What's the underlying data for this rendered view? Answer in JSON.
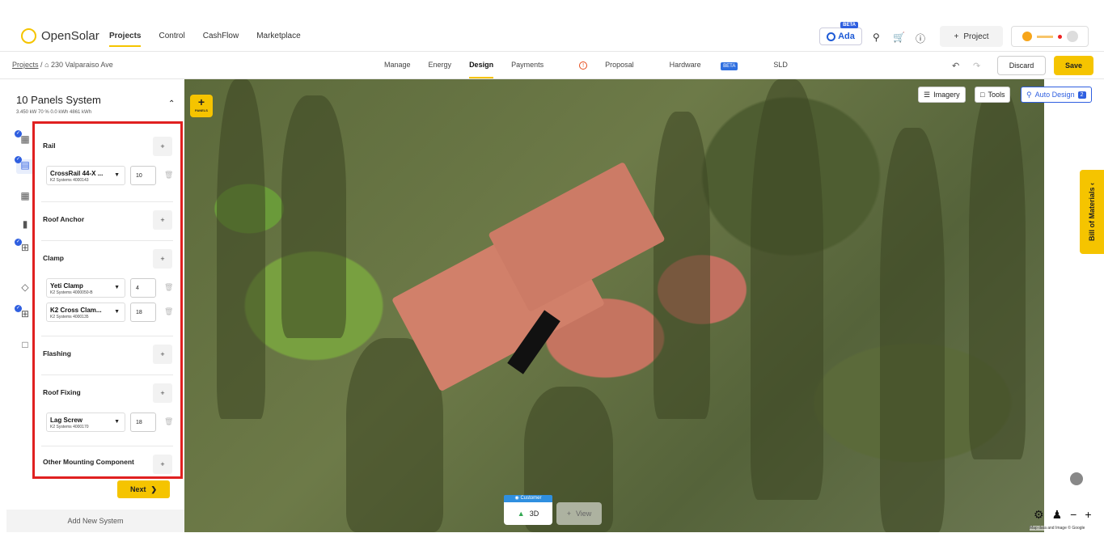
{
  "topnav": {
    "brand": "OpenSolar",
    "items": [
      "Projects",
      "Control",
      "CashFlow",
      "Marketplace"
    ],
    "ada_label": "Ada",
    "ada_badge": "BETA",
    "project_button": "Project"
  },
  "subnav": {
    "breadcrumb_root": "Projects",
    "breadcrumb_sep": "/",
    "address": "230 Valparaiso Ave",
    "tabs": [
      "Manage",
      "Energy",
      "Design",
      "Payments",
      "Proposal",
      "Hardware",
      "SLD"
    ],
    "hardware_badge": "BETA",
    "discard": "Discard",
    "save": "Save"
  },
  "system": {
    "title": "10 Panels System",
    "stats": "3.450 kW  70 %  0.0 kWh  4861 kWh"
  },
  "mounting": {
    "sections": [
      {
        "title": "Rail",
        "items": [
          {
            "name": "CrossRail 44-X ...",
            "sku": "K2 Systems 4000143",
            "qty": "10"
          }
        ]
      },
      {
        "title": "Roof Anchor",
        "items": []
      },
      {
        "title": "Clamp",
        "items": [
          {
            "name": "Yeti Clamp",
            "sku": "K2 Systems 4000050-B",
            "qty": "4"
          },
          {
            "name": "K2 Cross Clam...",
            "sku": "K2 Systems 4000135",
            "qty": "18"
          }
        ]
      },
      {
        "title": "Flashing",
        "items": []
      },
      {
        "title": "Roof Fixing",
        "items": [
          {
            "name": "Lag Screw",
            "sku": "K2 Systems 4000170",
            "qty": "18"
          }
        ]
      },
      {
        "title": "Other Mounting Component",
        "items": []
      }
    ],
    "next_label": "Next"
  },
  "add_new_system": "Add New System",
  "map": {
    "panels_label": "PANELS",
    "imagery": "Imagery",
    "tools": "Tools",
    "auto_design": "Auto Design",
    "auto_design_badge": "2",
    "bom": "Bill of Materials",
    "customer": "Customer",
    "view3d": "3D",
    "view": "View",
    "credit": "Map data and Image © Google"
  },
  "colors": {
    "accent": "#f5c400",
    "primary": "#2f5fe0",
    "highlight": "#e02020"
  }
}
